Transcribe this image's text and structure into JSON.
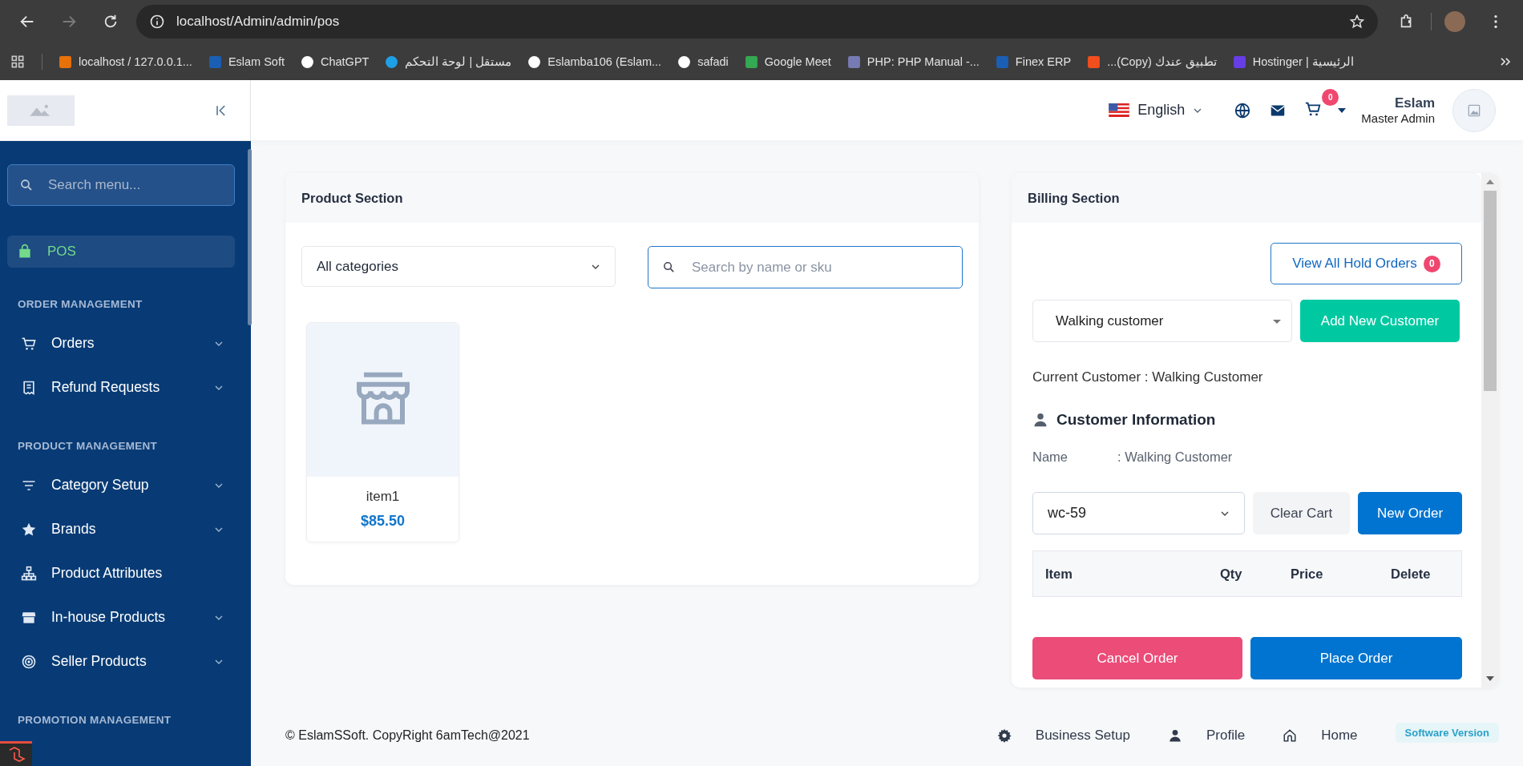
{
  "browser": {
    "url": "localhost/Admin/admin/pos",
    "bookmarks": [
      {
        "label": "localhost / 127.0.0.1..."
      },
      {
        "label": "Eslam Soft"
      },
      {
        "label": "ChatGPT"
      },
      {
        "label": "مستقل | لوحة التحكم"
      },
      {
        "label": "Eslamba106 (Eslam..."
      },
      {
        "label": "safadi"
      },
      {
        "label": "Google Meet"
      },
      {
        "label": "PHP: PHP Manual -..."
      },
      {
        "label": "Finex ERP"
      },
      {
        "label": "تطبيق عندك (Copy)..."
      },
      {
        "label": "الرئيسية | Hostinger"
      }
    ]
  },
  "header": {
    "language": "English",
    "cart_count": "0",
    "user_name": "Eslam",
    "user_role": "Master Admin"
  },
  "sidebar": {
    "search_placeholder": "Search menu...",
    "top_item": {
      "label": "POS",
      "selected": true
    },
    "sections": [
      {
        "title": "ORDER MANAGEMENT",
        "items": [
          {
            "label": "Orders",
            "has_submenu": true
          },
          {
            "label": "Refund Requests",
            "has_submenu": true
          }
        ]
      },
      {
        "title": "PRODUCT MANAGEMENT",
        "items": [
          {
            "label": "Category Setup",
            "has_submenu": true
          },
          {
            "label": "Brands",
            "has_submenu": true
          },
          {
            "label": "Product Attributes",
            "has_submenu": false
          },
          {
            "label": "In-house Products",
            "has_submenu": true
          },
          {
            "label": "Seller Products",
            "has_submenu": true
          }
        ]
      },
      {
        "title": "PROMOTION MANAGEMENT"
      }
    ]
  },
  "product_section": {
    "title": "Product Section",
    "category": "All categories",
    "search_placeholder": "Search by name or sku",
    "products": [
      {
        "name": "item1",
        "price": "$85.50"
      }
    ]
  },
  "billing_section": {
    "title": "Billing Section",
    "hold_orders": {
      "label": "View All Hold Orders",
      "count": "0"
    },
    "customer": "Walking customer",
    "add_customer": "Add New Customer",
    "current_customer": "Current Customer : Walking Customer",
    "info_title": "Customer Information",
    "name_label": "Name",
    "name_value": ":  Walking Customer",
    "order": "wc-59",
    "clear_cart": "Clear Cart",
    "new_order": "New Order",
    "columns": [
      "Item",
      "Qty",
      "Price",
      "Delete"
    ],
    "cancel_order": "Cancel Order",
    "place_order": "Place Order"
  },
  "footer": {
    "copyright": "© EslamSSoft. CopyRight 6amTech@2021",
    "links": [
      {
        "label": "Business Setup"
      },
      {
        "label": "Profile"
      },
      {
        "label": "Home"
      }
    ],
    "version": "Software Version"
  }
}
